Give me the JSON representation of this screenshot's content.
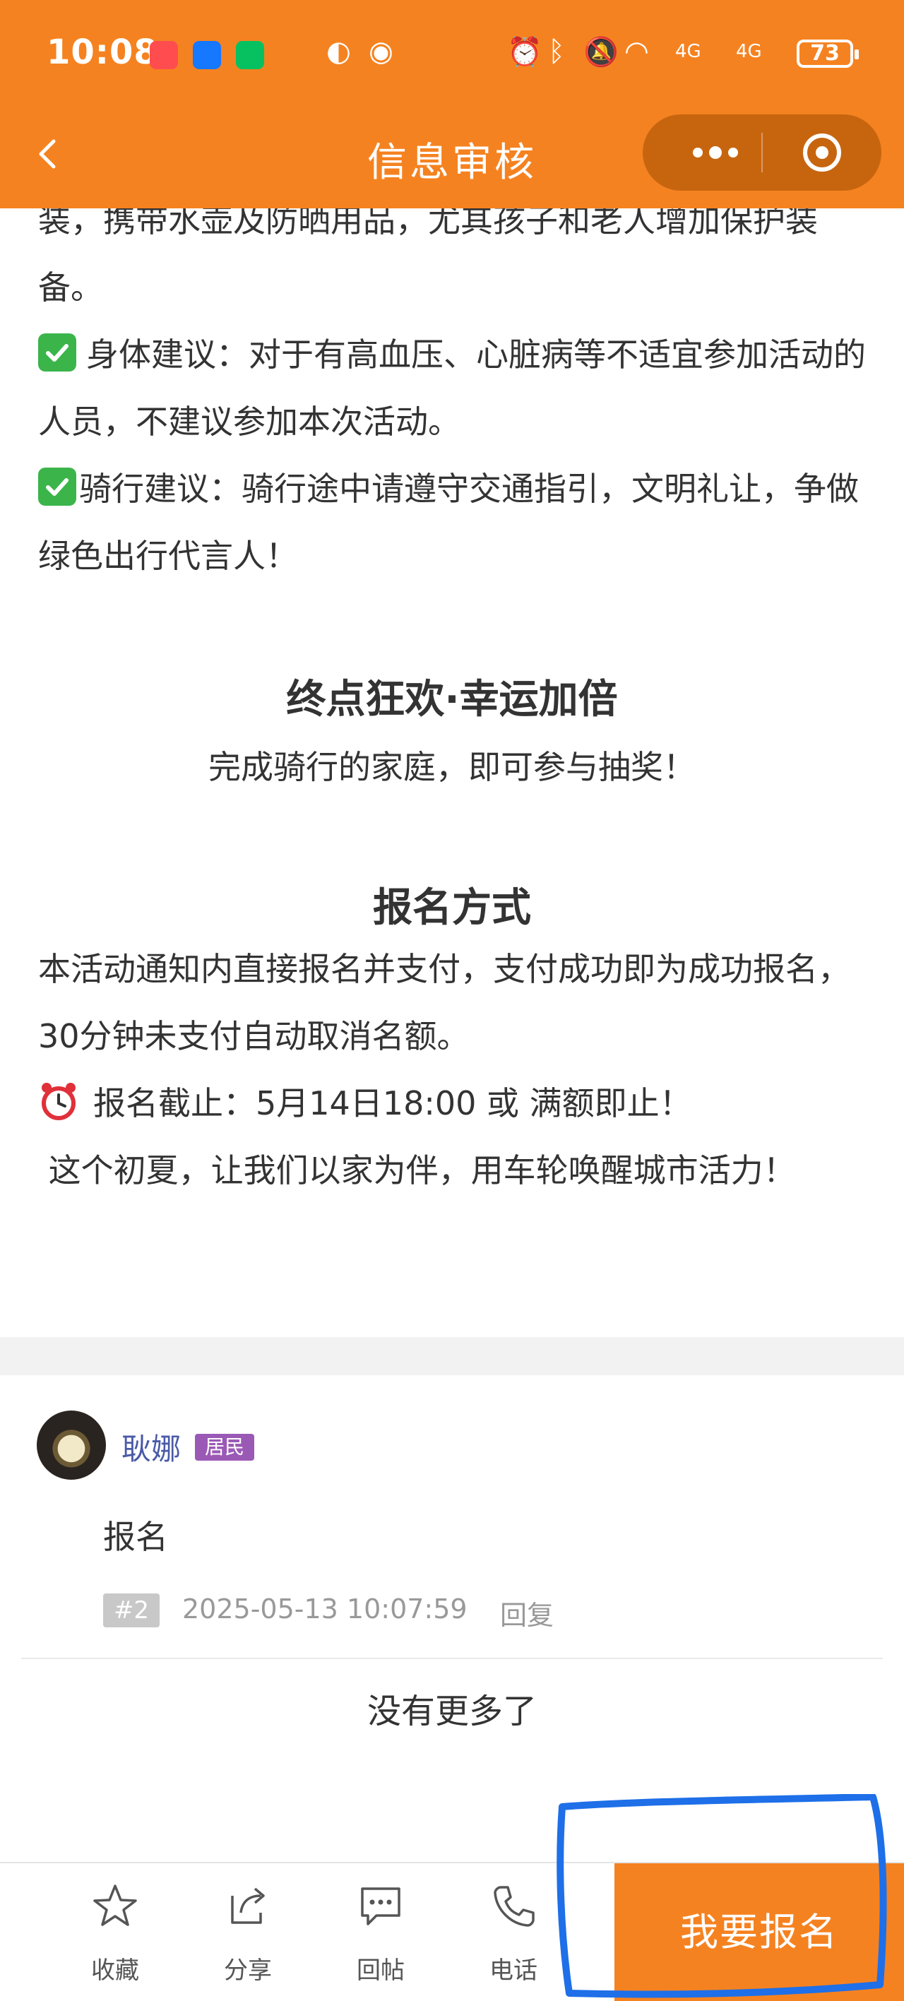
{
  "status_bar": {
    "time": "10:08",
    "battery": "73",
    "network": "4G"
  },
  "nav": {
    "title": "信息审核",
    "back_icon": "chevron-left-icon",
    "more_icon": "more-dots-icon",
    "close_icon": "target-circle-icon"
  },
  "article": {
    "gear_tail": "装，携带水壶及防晒用品，尤其孩子和老人增加保护装备。",
    "health_tip": "身体建议：对于有高血压、心脏病等不适宜参加活动的人员，不建议参加本次活动。",
    "cycling_tip": "骑行建议：骑行途中请遵守交通指引，文明礼让，争做绿色出行代言人！",
    "lottery_heading": "终点狂欢·幸运加倍",
    "lottery_text": "完成骑行的家庭，即可参与抽奖！",
    "signup_heading": "报名方式",
    "signup_text": "本活动通知内直接报名并支付，支付成功即为成功报名，30分钟未支付自动取消名额。",
    "deadline": "报名截止：5月14日18:00 或 满额即止！",
    "closing": " 这个初夏，让我们以家为伴，用车轮唤醒城市活力！"
  },
  "comment": {
    "user_name": "耿娜",
    "user_tag": "居民",
    "text": "报名",
    "floor": "#2",
    "time": "2025-05-13 10:07:59",
    "reply_label": "回复"
  },
  "list_end": "没有更多了",
  "bottom_bar": {
    "favorite_label": "收藏",
    "share_label": "分享",
    "reply_label": "回帖",
    "phone_label": "电话",
    "signup_button": "我要报名"
  },
  "colors": {
    "brand_orange": "#f58220",
    "check_green": "#3bb54a",
    "tag_purple": "#9b59b6",
    "annotation_blue": "#1e6fe8"
  }
}
